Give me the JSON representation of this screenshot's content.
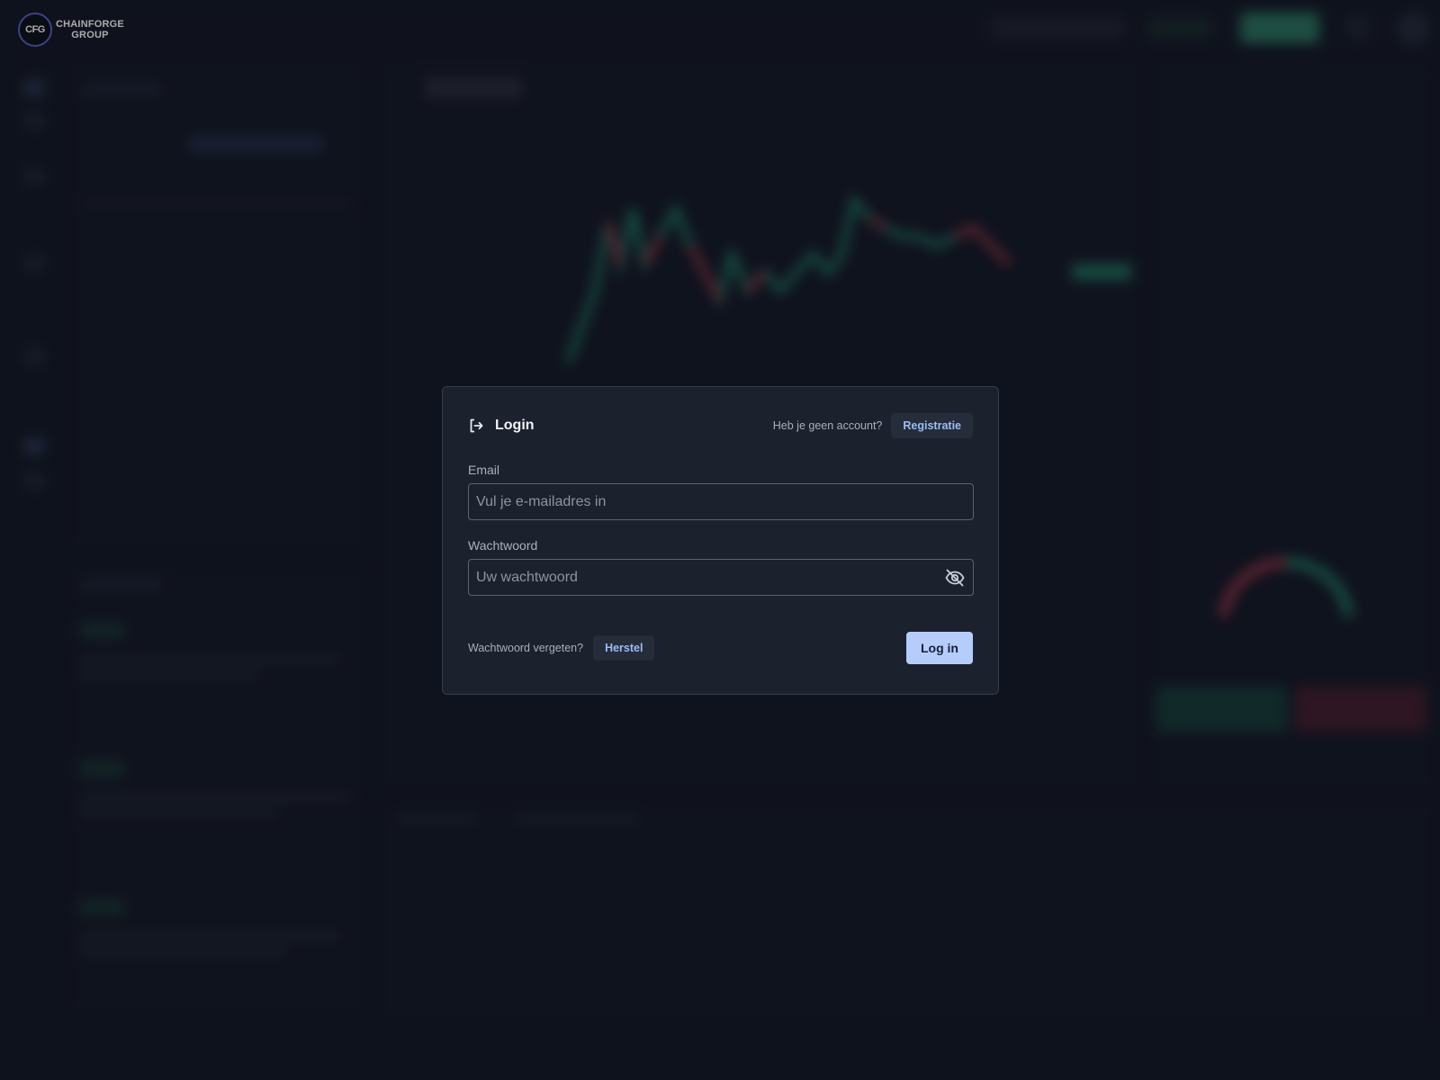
{
  "brand": {
    "logo_mark": "CFG",
    "name_line1": "CHAINFORGE",
    "name_line2": "GROUP"
  },
  "modal": {
    "title": "Login",
    "title_icon": "login-arrow-icon",
    "no_account_text": "Heb je geen account?",
    "register_label": "Registratie",
    "email_label": "Email",
    "email_placeholder": "Vul je e-mailadres in",
    "email_value": "",
    "password_label": "Wachtwoord",
    "password_placeholder": "Uw wachtwoord",
    "password_value": "",
    "password_toggle_icon": "eye-off-icon",
    "forgot_text": "Wachtwoord vergeten?",
    "reset_label": "Herstel",
    "submit_label": "Log in"
  },
  "colors": {
    "background": "#121722",
    "modal_bg": "#1b212d",
    "accent_link": "#9bbcf5",
    "primary_button": "#b6cdfb",
    "candle_up": "#2bb58a",
    "candle_down": "#e0465e"
  }
}
